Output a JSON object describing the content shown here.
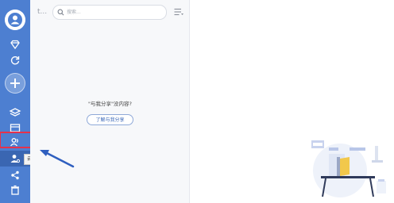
{
  "sidebar": {
    "nav_items": [
      {
        "name": "diamond-icon"
      },
      {
        "name": "refresh-icon"
      },
      {
        "name": "layers-icon"
      },
      {
        "name": "folder-icon"
      },
      {
        "name": "shared-icon"
      },
      {
        "name": "cooperate-icon"
      },
      {
        "name": "share-icon"
      },
      {
        "name": "trash-icon"
      }
    ],
    "tooltip": "云协作"
  },
  "panel": {
    "back_icon": "t...",
    "search_placeholder": "搜索...",
    "empty_message": "\"与我分享\"没内容?",
    "learn_button": "了解与我分享"
  },
  "colors": {
    "sidebar": "#4d7fd1",
    "highlight": "#e6324b",
    "arrow": "#2f5fbf"
  }
}
